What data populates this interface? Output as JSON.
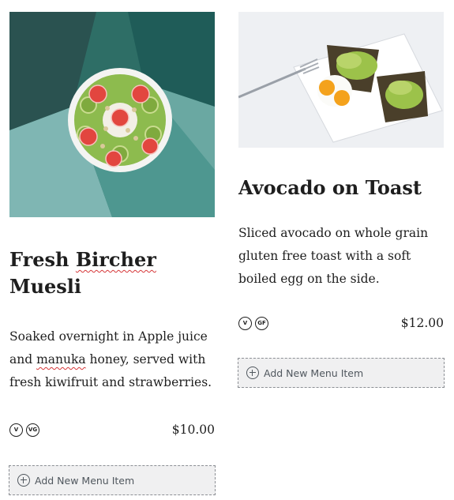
{
  "items": [
    {
      "title_word1": "Fresh",
      "title_word2": "Bircher",
      "title_word3": "Muesli",
      "desc_part1": "Soaked overnight in Apple juice and ",
      "desc_misspelled": "manuka",
      "desc_part2": " honey, served with fresh kiwifruit and strawberries.",
      "badges": [
        "V",
        "VG"
      ],
      "price": "$10.00",
      "add_label": "Add New Menu Item",
      "image_icon": "smoothie-bowl-photo"
    },
    {
      "title": "Avocado on Toast",
      "desc": "Sliced avocado on whole grain gluten free toast with a soft boiled egg on the side.",
      "badges": [
        "V",
        "GF"
      ],
      "price": "$12.00",
      "add_label": "Add New Menu Item",
      "image_icon": "avocado-toast-photo"
    }
  ]
}
